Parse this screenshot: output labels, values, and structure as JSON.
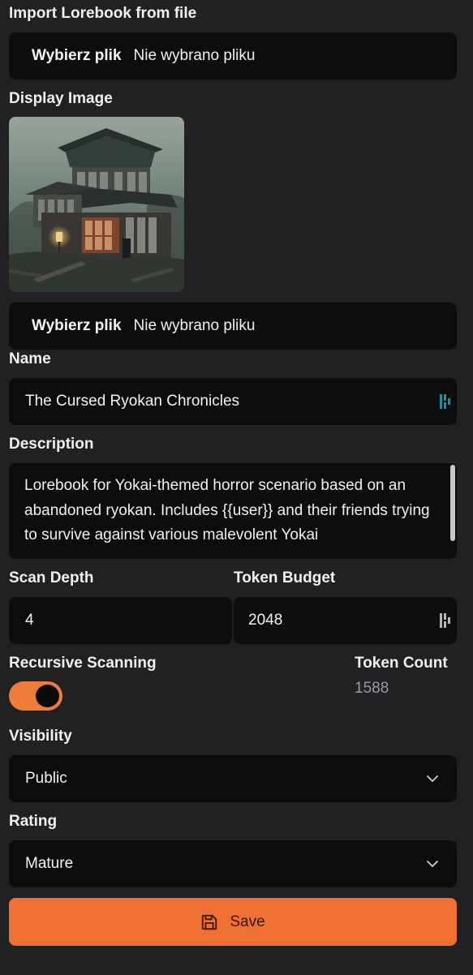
{
  "import": {
    "label": "Import Lorebook from file",
    "button_label": "Wybierz plik",
    "status": "Nie wybrano pliku"
  },
  "display_image": {
    "label": "Display Image",
    "image_description": "haunted Japanese ryokan inn in fog",
    "button_label": "Wybierz plik",
    "status": "Nie wybrano pliku"
  },
  "name": {
    "label": "Name",
    "value": "The Cursed Ryokan Chronicles",
    "icon": "password-manager-icon"
  },
  "description": {
    "label": "Description",
    "value": "Lorebook for Yokai-themed horror scenario based on an abandoned ryokan. Includes {{user}} and their friends trying to survive against various malevolent Yokai"
  },
  "scan_depth": {
    "label": "Scan Depth",
    "value": "4"
  },
  "token_budget": {
    "label": "Token Budget",
    "value": "2048",
    "icon": "password-manager-icon"
  },
  "recursive_scanning": {
    "label": "Recursive Scanning",
    "enabled": true
  },
  "token_count": {
    "label": "Token Count",
    "value": "1588"
  },
  "visibility": {
    "label": "Visibility",
    "selected": "Public",
    "icon": "chevron-down-icon"
  },
  "rating": {
    "label": "Rating",
    "selected": "Mature",
    "icon": "chevron-down-icon"
  },
  "save": {
    "label": "Save",
    "icon": "save-icon"
  },
  "colors": {
    "background": "#212124",
    "field": "#0d0d0e",
    "accent": "#ee7033",
    "muted_text": "#9a9a9f"
  }
}
